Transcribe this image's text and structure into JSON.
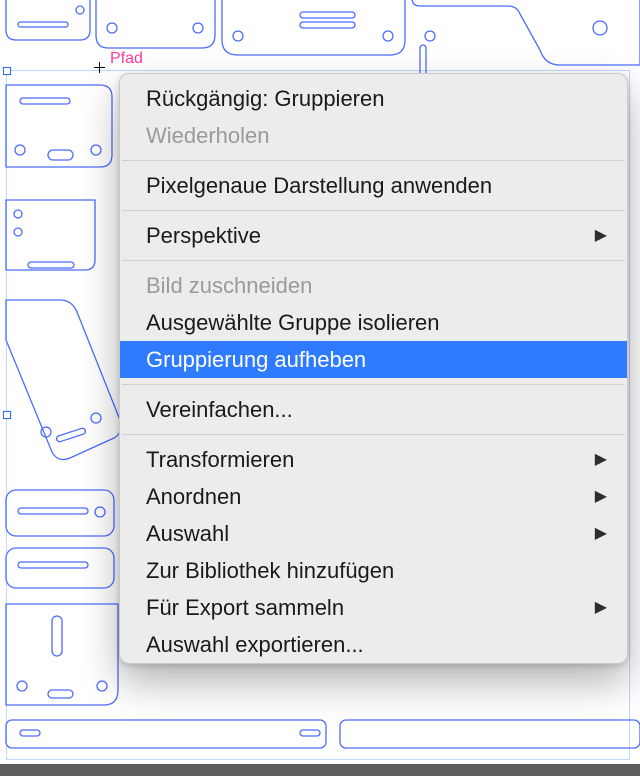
{
  "selection_label": "Pfad",
  "context_menu": {
    "items": [
      {
        "label": "Rückgängig: Gruppieren",
        "enabled": true,
        "submenu": false,
        "highlight": false
      },
      {
        "label": "Wiederholen",
        "enabled": false,
        "submenu": false,
        "highlight": false
      },
      {
        "sep": true
      },
      {
        "label": "Pixelgenaue Darstellung anwenden",
        "enabled": true,
        "submenu": false,
        "highlight": false
      },
      {
        "sep": true
      },
      {
        "label": "Perspektive",
        "enabled": true,
        "submenu": true,
        "highlight": false
      },
      {
        "sep": true
      },
      {
        "label": "Bild zuschneiden",
        "enabled": false,
        "submenu": false,
        "highlight": false
      },
      {
        "label": "Ausgewählte Gruppe isolieren",
        "enabled": true,
        "submenu": false,
        "highlight": false
      },
      {
        "label": "Gruppierung aufheben",
        "enabled": true,
        "submenu": false,
        "highlight": true
      },
      {
        "sep": true
      },
      {
        "label": "Vereinfachen...",
        "enabled": true,
        "submenu": false,
        "highlight": false
      },
      {
        "sep": true
      },
      {
        "label": "Transformieren",
        "enabled": true,
        "submenu": true,
        "highlight": false
      },
      {
        "label": "Anordnen",
        "enabled": true,
        "submenu": true,
        "highlight": false
      },
      {
        "label": "Auswahl",
        "enabled": true,
        "submenu": true,
        "highlight": false
      },
      {
        "label": "Zur Bibliothek hinzufügen",
        "enabled": true,
        "submenu": false,
        "highlight": false
      },
      {
        "label": "Für Export sammeln",
        "enabled": true,
        "submenu": true,
        "highlight": false
      },
      {
        "label": "Auswahl exportieren...",
        "enabled": true,
        "submenu": false,
        "highlight": false
      }
    ]
  },
  "colors": {
    "outline": "#4e6bff",
    "menu_highlight": "#2f7bff",
    "selection_label": "#ff3aa6"
  }
}
